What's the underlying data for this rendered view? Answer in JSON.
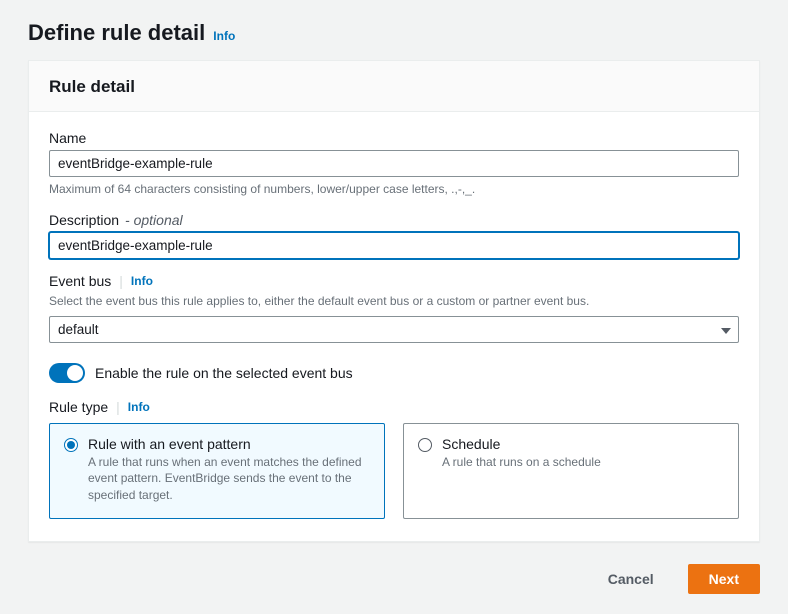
{
  "header": {
    "title": "Define rule detail",
    "info": "Info"
  },
  "panel": {
    "title": "Rule detail"
  },
  "fields": {
    "name": {
      "label": "Name",
      "value": "eventBridge-example-rule",
      "helper": "Maximum of 64 characters consisting of numbers, lower/upper case letters, .,-,_."
    },
    "description": {
      "label": "Description",
      "optional": "- optional",
      "value": "eventBridge-example-rule"
    },
    "eventBus": {
      "label": "Event bus",
      "info": "Info",
      "helper": "Select the event bus this rule applies to, either the default event bus or a custom or partner event bus.",
      "value": "default"
    },
    "enable": {
      "label": "Enable the rule on the selected event bus"
    },
    "ruleType": {
      "label": "Rule type",
      "info": "Info",
      "options": [
        {
          "title": "Rule with an event pattern",
          "desc": "A rule that runs when an event matches the defined event pattern. EventBridge sends the event to the specified target."
        },
        {
          "title": "Schedule",
          "desc": "A rule that runs on a schedule"
        }
      ]
    }
  },
  "footer": {
    "cancel": "Cancel",
    "next": "Next"
  }
}
